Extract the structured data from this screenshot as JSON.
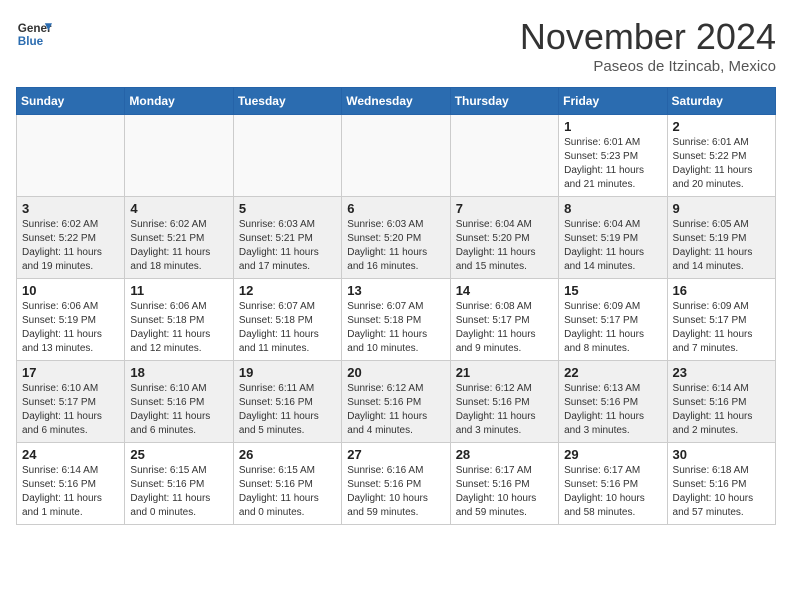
{
  "header": {
    "logo_line1": "General",
    "logo_line2": "Blue",
    "month": "November 2024",
    "location": "Paseos de Itzincab, Mexico"
  },
  "days_of_week": [
    "Sunday",
    "Monday",
    "Tuesday",
    "Wednesday",
    "Thursday",
    "Friday",
    "Saturday"
  ],
  "weeks": [
    {
      "days": [
        {
          "date": "",
          "info": ""
        },
        {
          "date": "",
          "info": ""
        },
        {
          "date": "",
          "info": ""
        },
        {
          "date": "",
          "info": ""
        },
        {
          "date": "",
          "info": ""
        },
        {
          "date": "1",
          "info": "Sunrise: 6:01 AM\nSunset: 5:23 PM\nDaylight: 11 hours and 21 minutes."
        },
        {
          "date": "2",
          "info": "Sunrise: 6:01 AM\nSunset: 5:22 PM\nDaylight: 11 hours and 20 minutes."
        }
      ]
    },
    {
      "days": [
        {
          "date": "3",
          "info": "Sunrise: 6:02 AM\nSunset: 5:22 PM\nDaylight: 11 hours and 19 minutes."
        },
        {
          "date": "4",
          "info": "Sunrise: 6:02 AM\nSunset: 5:21 PM\nDaylight: 11 hours and 18 minutes."
        },
        {
          "date": "5",
          "info": "Sunrise: 6:03 AM\nSunset: 5:21 PM\nDaylight: 11 hours and 17 minutes."
        },
        {
          "date": "6",
          "info": "Sunrise: 6:03 AM\nSunset: 5:20 PM\nDaylight: 11 hours and 16 minutes."
        },
        {
          "date": "7",
          "info": "Sunrise: 6:04 AM\nSunset: 5:20 PM\nDaylight: 11 hours and 15 minutes."
        },
        {
          "date": "8",
          "info": "Sunrise: 6:04 AM\nSunset: 5:19 PM\nDaylight: 11 hours and 14 minutes."
        },
        {
          "date": "9",
          "info": "Sunrise: 6:05 AM\nSunset: 5:19 PM\nDaylight: 11 hours and 14 minutes."
        }
      ]
    },
    {
      "days": [
        {
          "date": "10",
          "info": "Sunrise: 6:06 AM\nSunset: 5:19 PM\nDaylight: 11 hours and 13 minutes."
        },
        {
          "date": "11",
          "info": "Sunrise: 6:06 AM\nSunset: 5:18 PM\nDaylight: 11 hours and 12 minutes."
        },
        {
          "date": "12",
          "info": "Sunrise: 6:07 AM\nSunset: 5:18 PM\nDaylight: 11 hours and 11 minutes."
        },
        {
          "date": "13",
          "info": "Sunrise: 6:07 AM\nSunset: 5:18 PM\nDaylight: 11 hours and 10 minutes."
        },
        {
          "date": "14",
          "info": "Sunrise: 6:08 AM\nSunset: 5:17 PM\nDaylight: 11 hours and 9 minutes."
        },
        {
          "date": "15",
          "info": "Sunrise: 6:09 AM\nSunset: 5:17 PM\nDaylight: 11 hours and 8 minutes."
        },
        {
          "date": "16",
          "info": "Sunrise: 6:09 AM\nSunset: 5:17 PM\nDaylight: 11 hours and 7 minutes."
        }
      ]
    },
    {
      "days": [
        {
          "date": "17",
          "info": "Sunrise: 6:10 AM\nSunset: 5:17 PM\nDaylight: 11 hours and 6 minutes."
        },
        {
          "date": "18",
          "info": "Sunrise: 6:10 AM\nSunset: 5:16 PM\nDaylight: 11 hours and 6 minutes."
        },
        {
          "date": "19",
          "info": "Sunrise: 6:11 AM\nSunset: 5:16 PM\nDaylight: 11 hours and 5 minutes."
        },
        {
          "date": "20",
          "info": "Sunrise: 6:12 AM\nSunset: 5:16 PM\nDaylight: 11 hours and 4 minutes."
        },
        {
          "date": "21",
          "info": "Sunrise: 6:12 AM\nSunset: 5:16 PM\nDaylight: 11 hours and 3 minutes."
        },
        {
          "date": "22",
          "info": "Sunrise: 6:13 AM\nSunset: 5:16 PM\nDaylight: 11 hours and 3 minutes."
        },
        {
          "date": "23",
          "info": "Sunrise: 6:14 AM\nSunset: 5:16 PM\nDaylight: 11 hours and 2 minutes."
        }
      ]
    },
    {
      "days": [
        {
          "date": "24",
          "info": "Sunrise: 6:14 AM\nSunset: 5:16 PM\nDaylight: 11 hours and 1 minute."
        },
        {
          "date": "25",
          "info": "Sunrise: 6:15 AM\nSunset: 5:16 PM\nDaylight: 11 hours and 0 minutes."
        },
        {
          "date": "26",
          "info": "Sunrise: 6:15 AM\nSunset: 5:16 PM\nDaylight: 11 hours and 0 minutes."
        },
        {
          "date": "27",
          "info": "Sunrise: 6:16 AM\nSunset: 5:16 PM\nDaylight: 10 hours and 59 minutes."
        },
        {
          "date": "28",
          "info": "Sunrise: 6:17 AM\nSunset: 5:16 PM\nDaylight: 10 hours and 59 minutes."
        },
        {
          "date": "29",
          "info": "Sunrise: 6:17 AM\nSunset: 5:16 PM\nDaylight: 10 hours and 58 minutes."
        },
        {
          "date": "30",
          "info": "Sunrise: 6:18 AM\nSunset: 5:16 PM\nDaylight: 10 hours and 57 minutes."
        }
      ]
    }
  ]
}
